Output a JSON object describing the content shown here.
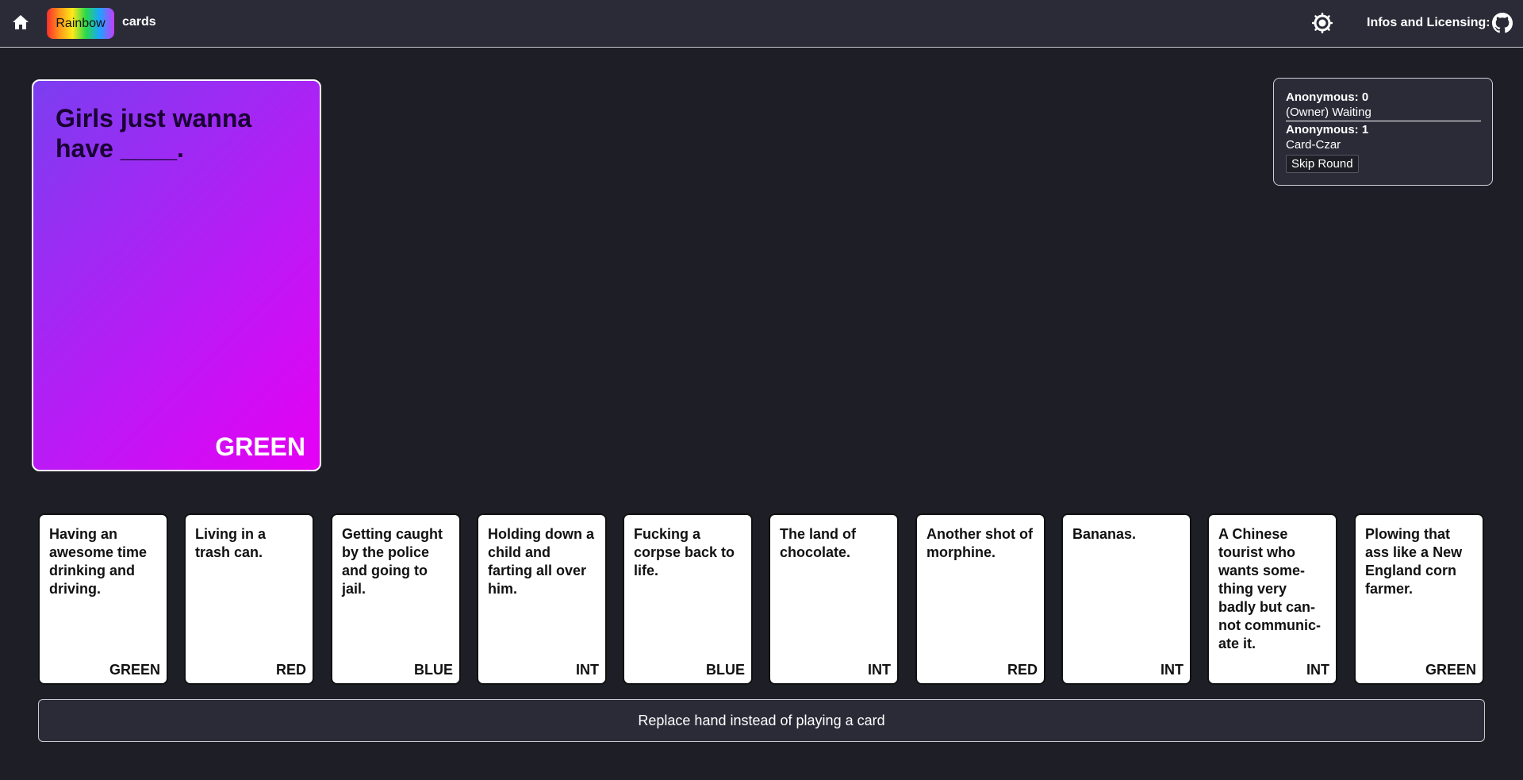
{
  "header": {
    "home_icon": "home-icon",
    "logo_badge": "Rainbow",
    "logo_text": "cards",
    "theme_icon": "sun-icon",
    "info_label": "Infos and Licensing:",
    "github_icon": "github-icon"
  },
  "black_card": {
    "prompt": "Girls just wanna have ____.",
    "color": "GREEN",
    "gradient": [
      "#7b3ef0",
      "#e600f5"
    ]
  },
  "players": [
    {
      "name": "Anonymous: 0",
      "status": "(Owner) Waiting"
    },
    {
      "name": "Anonymous: 1",
      "status": "Card-Czar"
    }
  ],
  "skip_label": "Skip Round",
  "hand": [
    {
      "text": "Having an awesome time drinking and driving.",
      "color": "GREEN"
    },
    {
      "text": "Living in a trash can.",
      "color": "RED"
    },
    {
      "text": "Getting caught by the police and going to jail.",
      "color": "BLUE"
    },
    {
      "text": "Holding down a child and farting all over him.",
      "color": "INT"
    },
    {
      "text": "Fucking a corpse back to life.",
      "color": "BLUE"
    },
    {
      "text": "The land of chocolate.",
      "color": "INT"
    },
    {
      "text": "Another shot of morphine.",
      "color": "RED"
    },
    {
      "text": "Bananas.",
      "color": "INT"
    },
    {
      "text": "A Chinese tourist who wants some-thing very badly but can-not communic-ate it.",
      "color": "INT"
    },
    {
      "text": "Plowing that ass like a New England corn farmer.",
      "color": "GREEN"
    }
  ],
  "replace_label": "Replace hand instead of playing a card"
}
